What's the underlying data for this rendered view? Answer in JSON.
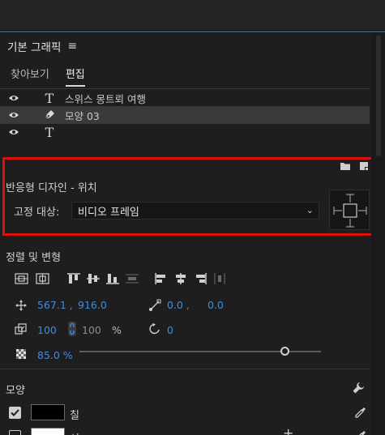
{
  "panel": {
    "title": "기본 그래픽",
    "menu_glyph": "≡"
  },
  "tabs": [
    {
      "label": "찾아보기",
      "active": false
    },
    {
      "label": "편집",
      "active": true
    }
  ],
  "layers": [
    {
      "type_icon": "T",
      "name": "스위스 몽트뢰 여행",
      "selected": false
    },
    {
      "type_icon": "pen",
      "name": "모양 03",
      "selected": true
    },
    {
      "type_icon": "T",
      "name": "",
      "selected": false
    }
  ],
  "responsive": {
    "title": "반응형 디자인 - 위치",
    "pin_label": "고정 대상:",
    "pin_value": "비디오 프레임"
  },
  "align": {
    "title": "정렬 및 변형"
  },
  "transform": {
    "position_x": "567.1 ,",
    "position_y": "916.0",
    "anchor_x": "0.0 ,",
    "anchor_y": "0.0",
    "scale": "100",
    "scale_linked": "100",
    "scale_unit": "%",
    "rotation": "0",
    "opacity": "85.0 %",
    "opacity_fraction": 0.85
  },
  "appearance": {
    "title": "모양",
    "fill_label": "칠",
    "fill_color": "#000000",
    "stroke_label": "선",
    "stroke_color": "#ffffff"
  },
  "colors": {
    "accent": "#3d8de0",
    "highlight_box": "#e0100f",
    "selected_row": "#3a3a3a"
  }
}
